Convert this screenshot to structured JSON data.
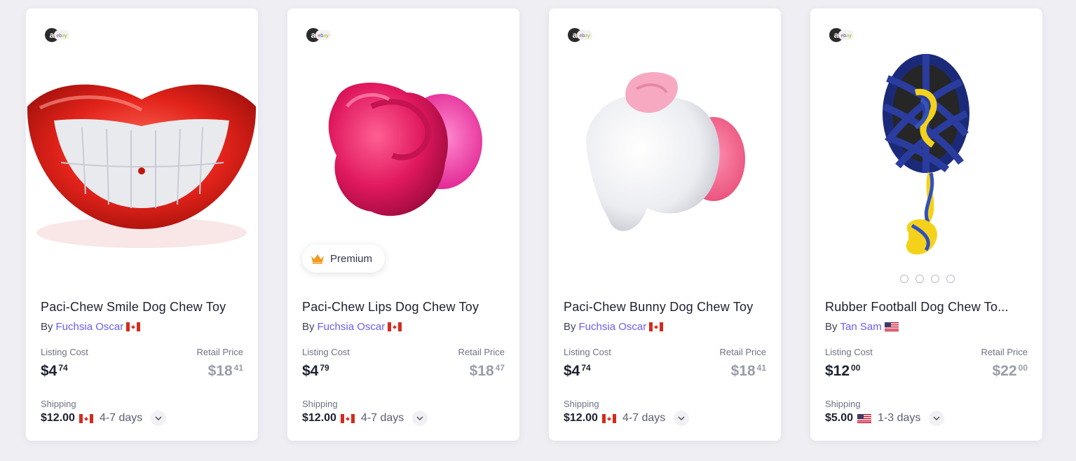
{
  "products": [
    {
      "source": "ebay",
      "title": "Paci-Chew Smile Dog Chew Toy",
      "by": "By",
      "seller": "Fuchsia Oscar",
      "seller_country": "CA",
      "listing_cost_label": "Listing Cost",
      "listing_cost_dollars": "$4",
      "listing_cost_cents": "74",
      "retail_price_label": "Retail Price",
      "retail_price_dollars": "$18",
      "retail_price_cents": "41",
      "shipping_label": "Shipping",
      "shipping_cost": "$12.00",
      "shipping_country": "CA",
      "shipping_days": "4-7 days"
    },
    {
      "source": "ebay",
      "badge": "Premium",
      "title": "Paci-Chew Lips Dog Chew Toy",
      "by": "By",
      "seller": "Fuchsia Oscar",
      "seller_country": "CA",
      "listing_cost_label": "Listing Cost",
      "listing_cost_dollars": "$4",
      "listing_cost_cents": "79",
      "retail_price_label": "Retail Price",
      "retail_price_dollars": "$18",
      "retail_price_cents": "47",
      "shipping_label": "Shipping",
      "shipping_cost": "$12.00",
      "shipping_country": "CA",
      "shipping_days": "4-7 days"
    },
    {
      "source": "ebay",
      "title": "Paci-Chew Bunny Dog Chew Toy",
      "by": "By",
      "seller": "Fuchsia Oscar",
      "seller_country": "CA",
      "listing_cost_label": "Listing Cost",
      "listing_cost_dollars": "$4",
      "listing_cost_cents": "74",
      "retail_price_label": "Retail Price",
      "retail_price_dollars": "$18",
      "retail_price_cents": "41",
      "shipping_label": "Shipping",
      "shipping_cost": "$12.00",
      "shipping_country": "CA",
      "shipping_days": "4-7 days"
    },
    {
      "source": "ebay",
      "title": "Rubber Football Dog Chew To...",
      "by": "By",
      "seller": "Tan Sam",
      "seller_country": "US",
      "listing_cost_label": "Listing Cost",
      "listing_cost_dollars": "$12",
      "listing_cost_cents": "00",
      "retail_price_label": "Retail Price",
      "retail_price_dollars": "$22",
      "retail_price_cents": "00",
      "shipping_label": "Shipping",
      "shipping_cost": "$5.00",
      "shipping_country": "US",
      "shipping_days": "1-3 days",
      "image_dots": 4
    }
  ],
  "colors": {
    "seller_link": "#6a5cf2",
    "retail_price": "#9a9caa",
    "premium_crown": "#f29a1f"
  },
  "icons": {
    "source_logo": "ebay-logo-icon",
    "flag_ca": "canada-flag-icon",
    "flag_us": "usa-flag-icon",
    "crown": "crown-icon",
    "expand": "chevron-down-icon"
  }
}
